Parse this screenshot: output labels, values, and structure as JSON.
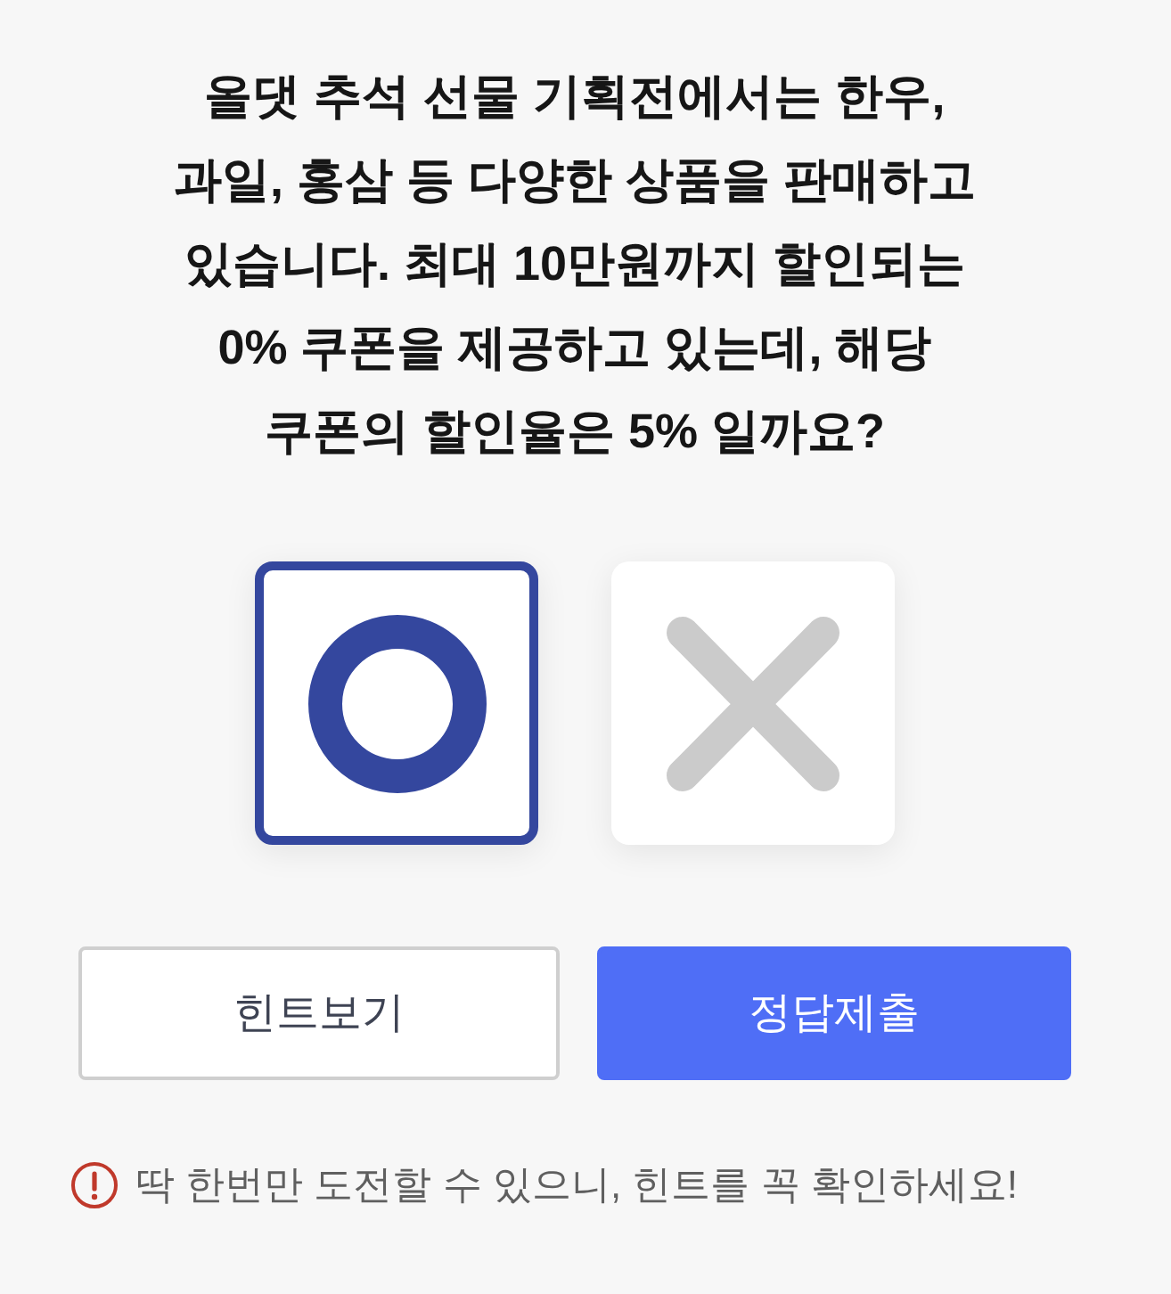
{
  "question": "올댓 추석 선물 기획전에서는 한우,\n과일, 홍삼 등 다양한 상품을 판매하고\n있습니다. 최대 10만원까지 할인되는\n0% 쿠폰을 제공하고 있는데, 해당\n쿠폰의 할인율은 5% 일까요?",
  "options": [
    {
      "kind": "o",
      "selected": true
    },
    {
      "kind": "x",
      "selected": false
    }
  ],
  "buttons": [
    {
      "kind": "outline",
      "label": "힌트보기"
    },
    {
      "kind": "primary",
      "label": "정답제출"
    }
  ],
  "notice": {
    "text": "딱 한번만 도전할 수 있으니, 힌트를 꼭 확인하세요!"
  }
}
